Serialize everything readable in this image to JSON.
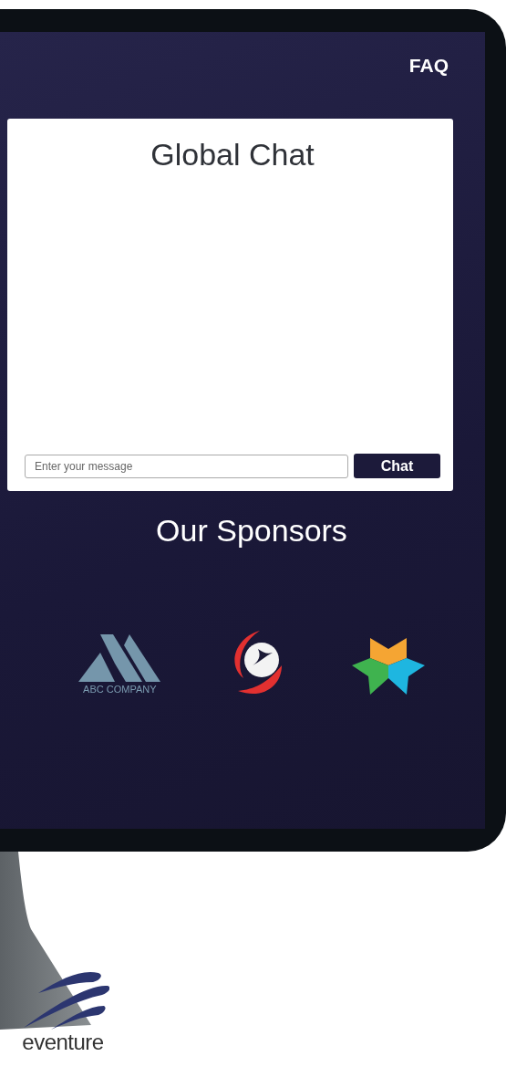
{
  "nav": {
    "link": "FAQ"
  },
  "chat": {
    "title": "Global Chat",
    "input": {
      "placeholder": "Enter your message"
    },
    "send_button": "Chat"
  },
  "sponsors": {
    "title": "Our Sponsors",
    "logos": [
      {
        "kind": "mountain",
        "caption": "ABC COMPANY"
      },
      {
        "kind": "bird"
      },
      {
        "kind": "star"
      }
    ]
  },
  "brand": {
    "name": "eventure"
  }
}
